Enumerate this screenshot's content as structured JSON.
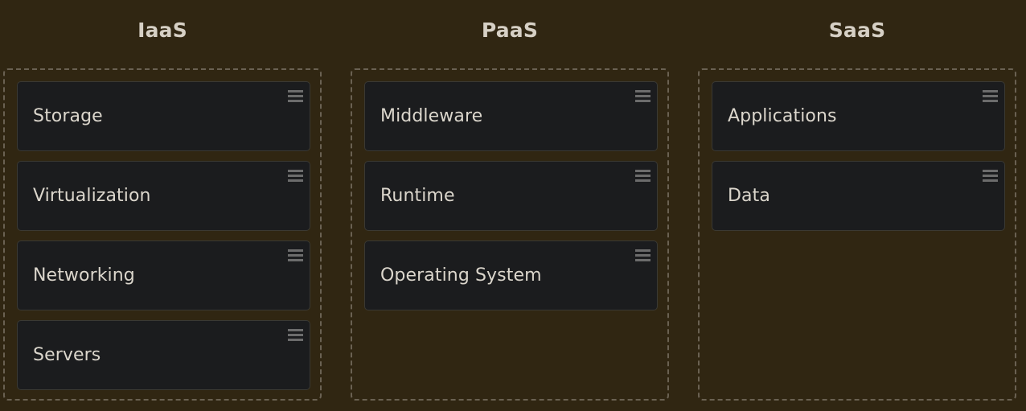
{
  "columns": [
    {
      "title": "IaaS",
      "cards": [
        "Storage",
        "Virtualization",
        "Networking",
        "Servers"
      ]
    },
    {
      "title": "PaaS",
      "cards": [
        "Middleware",
        "Runtime",
        "Operating System"
      ]
    },
    {
      "title": "SaaS",
      "cards": [
        "Applications",
        "Data"
      ]
    }
  ],
  "icons": {
    "drag_handle": "drag-handle-icon"
  },
  "colors": {
    "background": "#302612",
    "card": "#1b1c1e",
    "text": "#dbd6cc",
    "dashed_border": "#6a6152"
  }
}
